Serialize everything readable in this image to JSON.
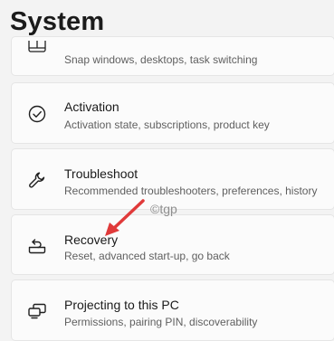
{
  "page": {
    "title": "System"
  },
  "items": [
    {
      "title": "",
      "description": "Snap windows, desktops, task switching",
      "icon": "snap-windows-icon"
    },
    {
      "title": "Activation",
      "description": "Activation state, subscriptions, product key",
      "icon": "checkmark-circle-icon"
    },
    {
      "title": "Troubleshoot",
      "description": "Recommended troubleshooters, preferences, history",
      "icon": "wrench-icon"
    },
    {
      "title": "Recovery",
      "description": "Reset, advanced start-up, go back",
      "icon": "recovery-icon"
    },
    {
      "title": "Projecting to this PC",
      "description": "Permissions, pairing PIN, discoverability",
      "icon": "projecting-icon"
    }
  ],
  "watermark": {
    "text": "©tgp"
  },
  "annotation": {
    "arrow_color": "#e03a3a"
  }
}
